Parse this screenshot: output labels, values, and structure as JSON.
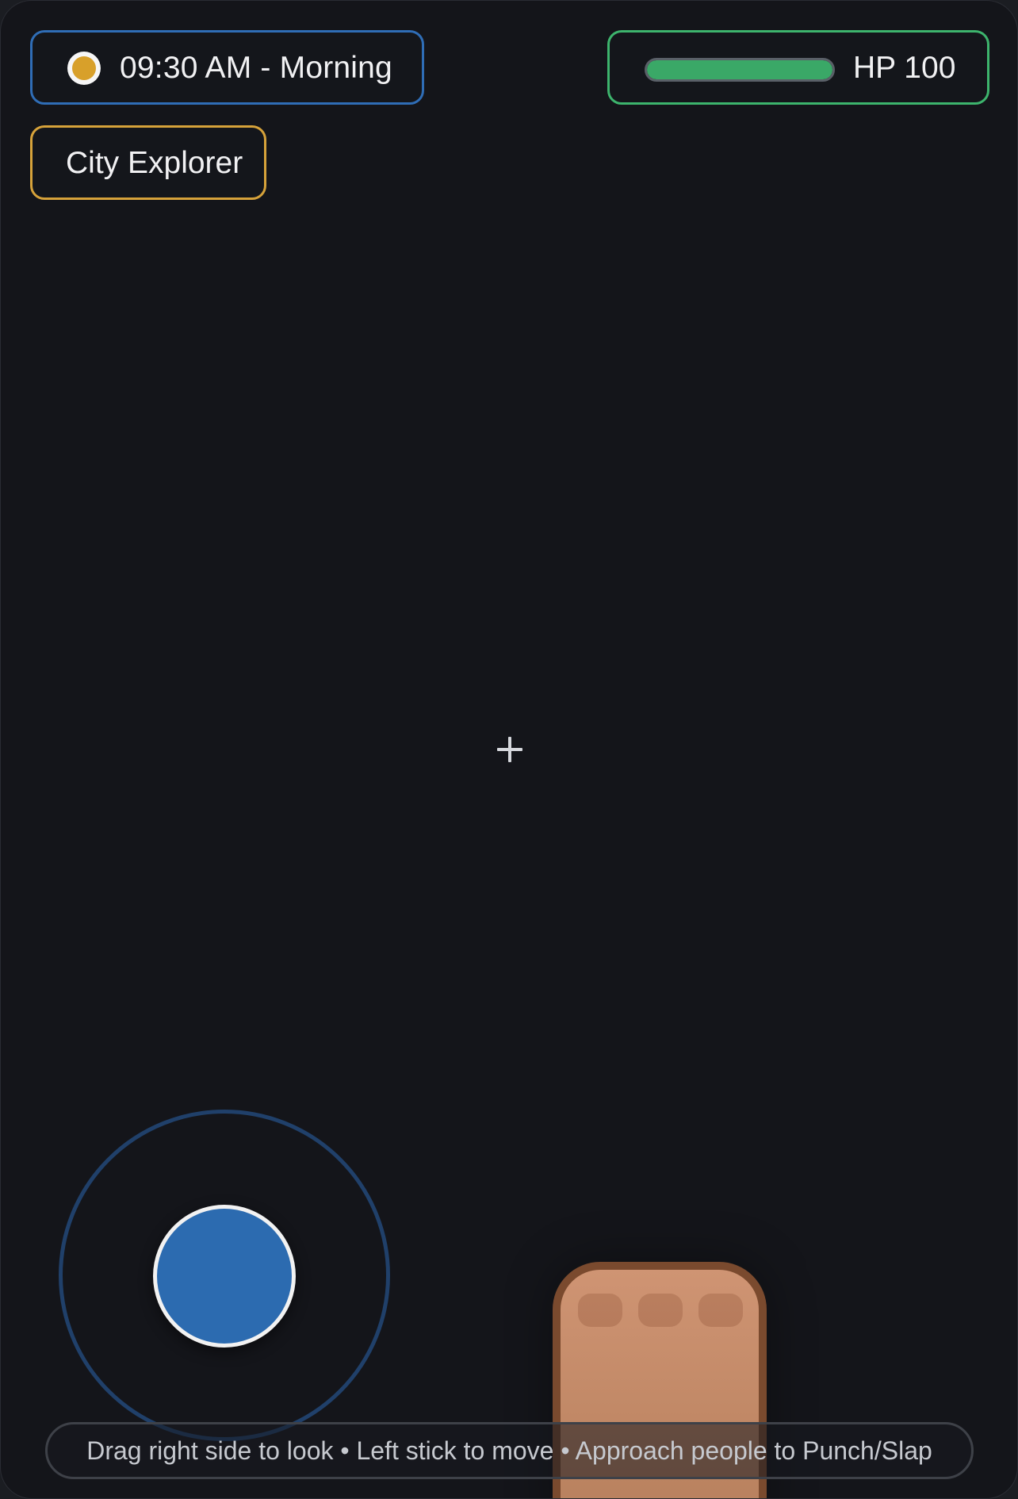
{
  "hud": {
    "time": {
      "icon": "sun-icon",
      "label": "09:30 AM - Morning",
      "border_color": "#2f6db6",
      "icon_color": "#d8a02a"
    },
    "health": {
      "label": "HP 100",
      "value": 100,
      "max": 100,
      "fill_fraction": 1.0,
      "border_color": "#3db46d",
      "fill_color": "#3aa867"
    },
    "mode": {
      "label": "City Explorer",
      "border_color": "#d6a23a"
    }
  },
  "crosshair": {
    "icon": "crosshair-icon"
  },
  "joystick": {
    "knob_color": "#2c6bb0",
    "ring_color": "#20406a"
  },
  "hand": {
    "icon": "fist-icon",
    "skin_color": "#cf9473"
  },
  "hint": {
    "text": "Drag right side to look • Left stick to move • Approach people to Punch/Slap"
  }
}
